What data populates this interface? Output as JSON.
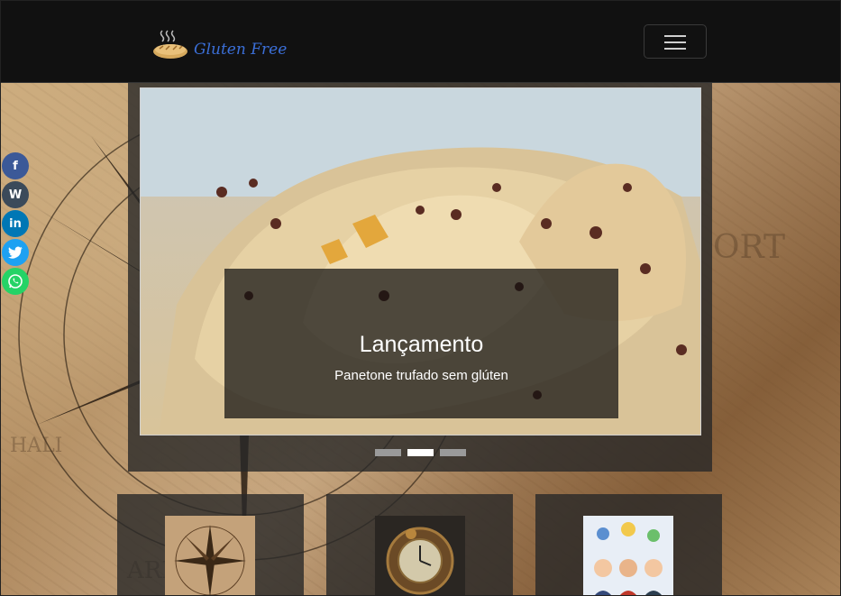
{
  "brand": {
    "name": "Gluten Free",
    "logo_icon": "bread-logo-icon"
  },
  "nav": {
    "toggle_icon": "hamburger-menu-icon"
  },
  "social": [
    {
      "name": "facebook",
      "glyph": "f",
      "color": "#3b5998"
    },
    {
      "name": "wordpress",
      "glyph": "W",
      "color": "#3b4a5a"
    },
    {
      "name": "linkedin",
      "glyph": "in",
      "color": "#0077b5"
    },
    {
      "name": "twitter",
      "glyph": "t",
      "color": "#1da1f2"
    },
    {
      "name": "whatsapp",
      "glyph": "w",
      "color": "#25d366"
    }
  ],
  "carousel": {
    "caption_title": "Lançamento",
    "caption_text": "Panetone trufado sem glúten",
    "slide_count": 3,
    "active_index": 1
  },
  "cards": [
    {
      "image": "compass-rose-image"
    },
    {
      "image": "steampunk-clock-image"
    },
    {
      "image": "support-team-image"
    }
  ]
}
